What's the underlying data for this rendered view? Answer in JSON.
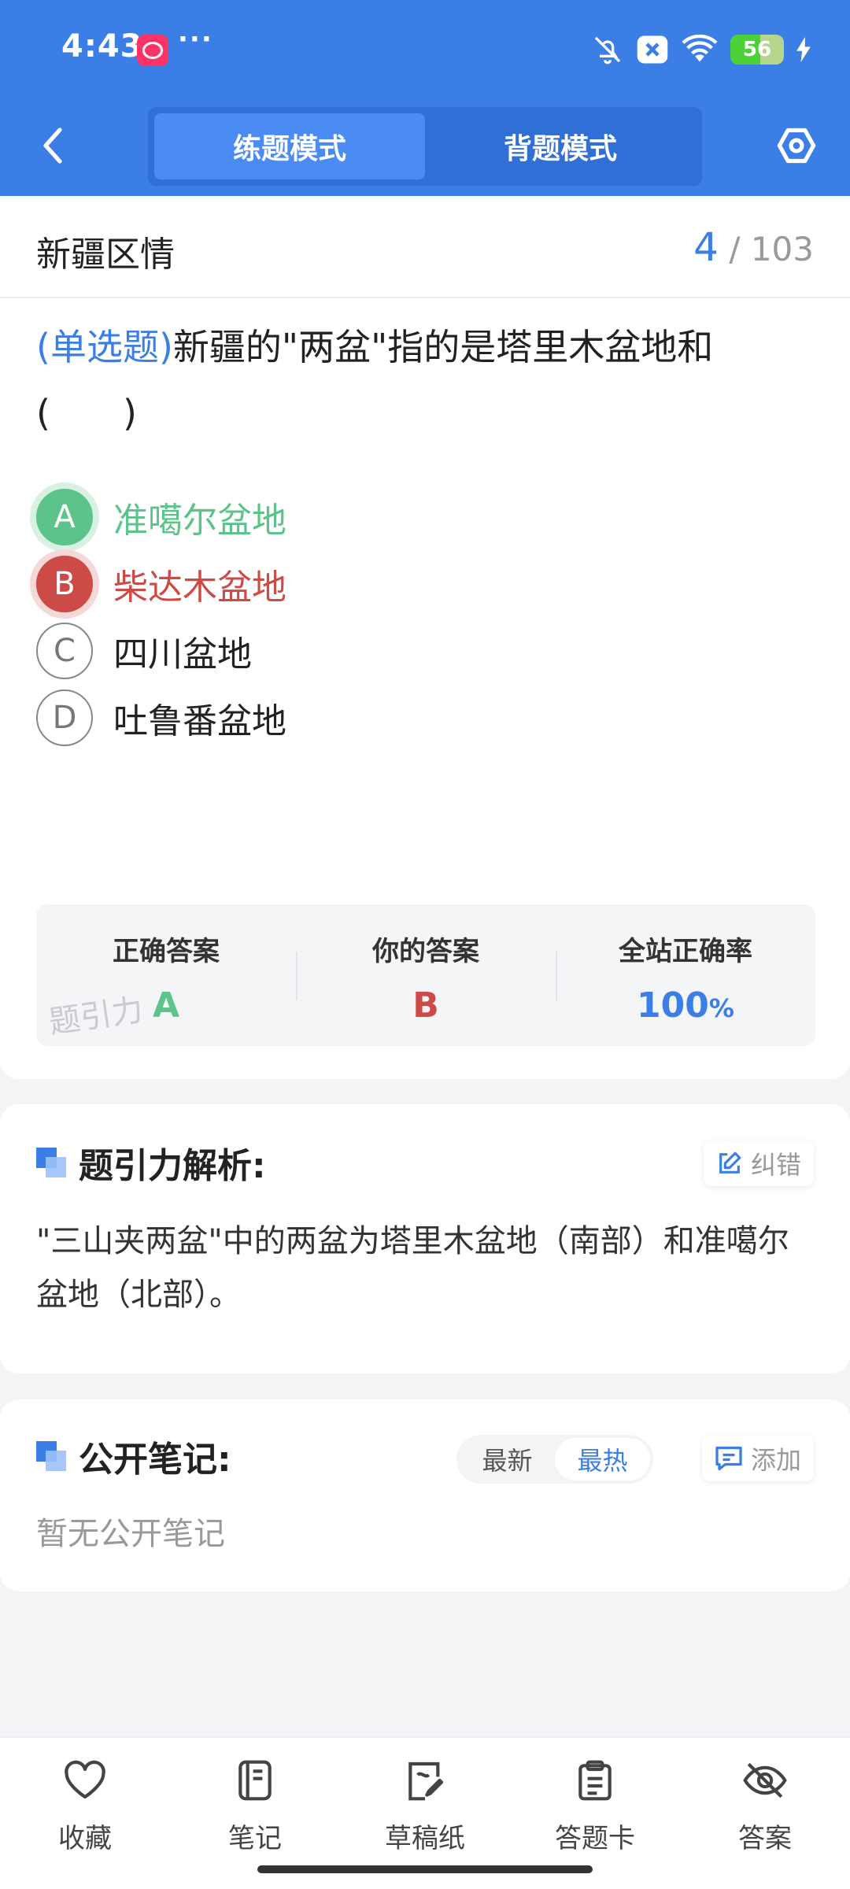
{
  "status_bar": {
    "time": "4:43",
    "more": "···",
    "battery": 56,
    "battery_label": "56"
  },
  "nav": {
    "modes": [
      {
        "label": "练题模式",
        "active": true
      },
      {
        "label": "背题模式",
        "active": false
      }
    ]
  },
  "category": {
    "title": "新疆区情",
    "current": "4",
    "total": "103",
    "separator": "/"
  },
  "question": {
    "type": "(单选题)",
    "text": "新疆的\"两盆\"指的是塔里木盆地和",
    "blank": "(　　)",
    "options": [
      {
        "letter": "A",
        "text": "准噶尔盆地",
        "state": "correct"
      },
      {
        "letter": "B",
        "text": "柴达木盆地",
        "state": "wrong"
      },
      {
        "letter": "C",
        "text": "四川盆地",
        "state": "normal"
      },
      {
        "letter": "D",
        "text": "吐鲁番盆地",
        "state": "normal"
      }
    ]
  },
  "result": {
    "correct_label": "正确答案",
    "correct_value": "A",
    "yours_label": "你的答案",
    "yours_value": "B",
    "rate_label": "全站正确率",
    "rate_value": "100",
    "rate_unit": "%",
    "watermark": "题引力"
  },
  "analysis": {
    "title": "题引力解析:",
    "report_label": "纠错",
    "text": "\"三山夹两盆\"中的两盆为塔里木盆地（南部）和准噶尔盆地（北部）。"
  },
  "notes": {
    "title": "公开笔记:",
    "tabs": [
      {
        "label": "最新",
        "active": false
      },
      {
        "label": "最热",
        "active": true
      }
    ],
    "add_label": "添加",
    "empty": "暂无公开笔记"
  },
  "bottom_bar": [
    {
      "label": "收藏",
      "icon": "heart-icon"
    },
    {
      "label": "笔记",
      "icon": "notebook-icon"
    },
    {
      "label": "草稿纸",
      "icon": "draft-paper-icon"
    },
    {
      "label": "答题卡",
      "icon": "clipboard-icon"
    },
    {
      "label": "答案",
      "icon": "eye-off-icon"
    }
  ],
  "colors": {
    "primary": "#3b7ee6",
    "correct": "#5cc48a",
    "wrong": "#cc4b47"
  }
}
